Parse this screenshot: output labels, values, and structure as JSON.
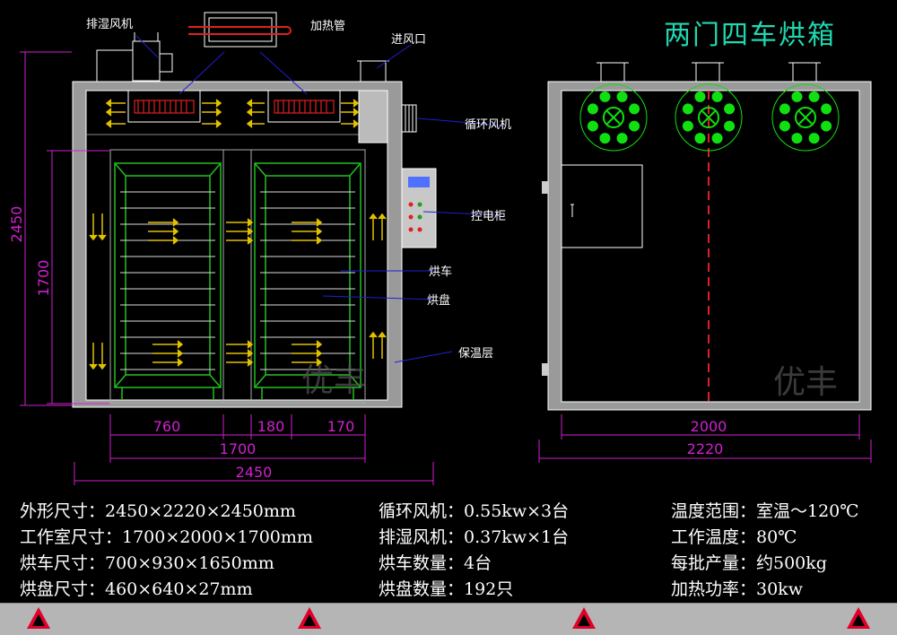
{
  "title": "两门四车烘箱",
  "labels": {
    "dehumid_fan": "排湿风机",
    "heater": "加热管",
    "air_inlet": "进风口",
    "circ_fan": "循环风机",
    "control_cabinet": "控电柜",
    "cart": "烘车",
    "tray": "烘盘",
    "insulation": "保温层",
    "watermark": "优丰"
  },
  "dimensions": {
    "height_total": "2450",
    "height_inner": "1700",
    "w_760": "760",
    "w_180": "180",
    "w_170": "170",
    "w_1700": "1700",
    "w_2450": "2450",
    "side_2000": "2000",
    "side_2220": "2220"
  },
  "specs": {
    "col1": [
      "外形尺寸：2450×2220×2450mm",
      "工作室尺寸：1700×2000×1700mm",
      "烘车尺寸：700×930×1650mm",
      "烘盘尺寸：460×640×27mm"
    ],
    "col2": [
      "循环风机：0.55kw×3台",
      "排湿风机：0.37kw×1台",
      "烘车数量：4台",
      "烘盘数量：192只"
    ],
    "col3": [
      "温度范围：室温～120℃",
      "工作温度：80℃",
      "每批产量：约500kg",
      "加热功率：30kw"
    ]
  },
  "colors": {
    "title": "#21d7b0",
    "dimension": "#d020d0",
    "cart": "#22c022",
    "arrow": "#e0c000",
    "leader": "#2020d0",
    "heater": "#e02020",
    "fan": "#10e010"
  }
}
